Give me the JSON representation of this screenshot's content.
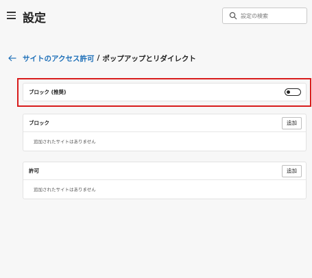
{
  "header": {
    "title": "設定",
    "search_placeholder": "設定の検索"
  },
  "breadcrumb": {
    "parent": "サイトのアクセス許可",
    "separator": "/",
    "current": "ポップアップとリダイレクト"
  },
  "block_recommended": {
    "label": "ブロック (推奨)",
    "toggle_on": false
  },
  "block_section": {
    "title": "ブロック",
    "add_label": "追加",
    "empty_message": "追加されたサイトはありません"
  },
  "allow_section": {
    "title": "許可",
    "add_label": "追加",
    "empty_message": "追加されたサイトはありません"
  },
  "colors": {
    "link": "#1d6fb8",
    "highlight": "#d81b1b",
    "background": "#f7f7f7"
  }
}
